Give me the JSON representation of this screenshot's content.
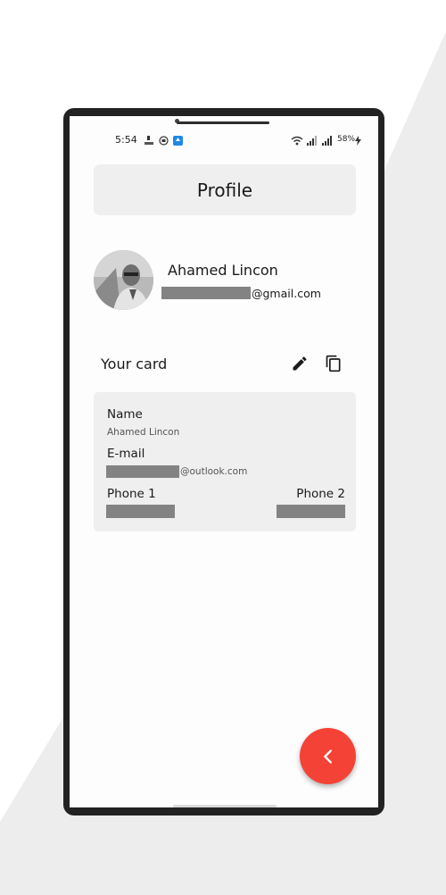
{
  "status_bar": {
    "time": "5:54",
    "battery": "58%"
  },
  "header": {
    "title": "Profile"
  },
  "profile": {
    "name": "Ahamed Lincon",
    "email_suffix": "@gmail.com"
  },
  "card_section": {
    "label": "Your card"
  },
  "card": {
    "name_label": "Name",
    "name_value": "Ahamed Lincon",
    "email_label": "E-mail",
    "email_suffix": "@outlook.com",
    "phone1_label": "Phone 1",
    "phone2_label": "Phone 2"
  },
  "icons": {
    "edit": "edit-icon",
    "copy": "copy-icon",
    "back": "chevron-left-icon"
  },
  "colors": {
    "fab": "#f44336",
    "card_bg": "#efefef",
    "redaction": "#838383"
  }
}
